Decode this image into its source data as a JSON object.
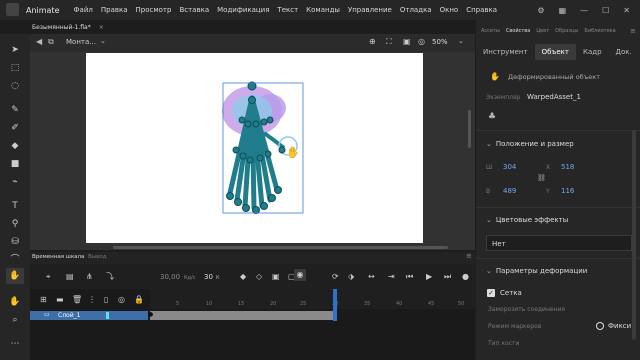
{
  "app": {
    "name": "Animate"
  },
  "menu": [
    "Файл",
    "Правка",
    "Просмотр",
    "Вставка",
    "Модификация",
    "Текст",
    "Команды",
    "Управление",
    "Отладка",
    "Окно",
    "Справка"
  ],
  "document": {
    "tab": "Безымянный-1.fla*",
    "close": "×"
  },
  "editbar": {
    "scene": "Монта...",
    "zoom": "50%"
  },
  "timeline": {
    "tab_active": "Временная шкала",
    "tab_inactive": "Вывод",
    "fps": "30,00",
    "fps_unit": "Кд/с",
    "frame": "30",
    "frame_unit": "К",
    "layer_name": "Слой_1",
    "ruler": [
      "5",
      "10",
      "15",
      "20",
      "25",
      "30",
      "35",
      "40",
      "45",
      "50"
    ]
  },
  "panels": {
    "top_tabs": [
      "Ассеты",
      "Свойства",
      "Цвет",
      "Образцы",
      "Библиотека"
    ],
    "sub_tabs": [
      "Инструмент",
      "Объект",
      "Кадр",
      "Док."
    ],
    "object_type": "Деформированный объект",
    "instance_label": "Экземпляр",
    "instance_name": "WarpedAsset_1",
    "position_section": "Положение и размер",
    "w_label": "Ш",
    "w": "304",
    "x_label": "X",
    "x": "518",
    "h_label": "В",
    "h": "489",
    "y_label": "Y",
    "y": "116",
    "color_section": "Цветовые эффекты",
    "color_value": "Нет",
    "warp_section": "Параметры деформации",
    "mesh_label": "Сетка",
    "freeze_label": "Заморозить соединения",
    "marker_mode_label": "Режим маркеров",
    "fixed_label": "Фикси",
    "bone_type_label": "Тип кости"
  },
  "colors": {
    "accent": "#2d74c9",
    "stage": "#ffffff",
    "bg": "#1d1d1d",
    "jellyfish": "#1f7d8c",
    "aura": "#c9a3ea"
  }
}
